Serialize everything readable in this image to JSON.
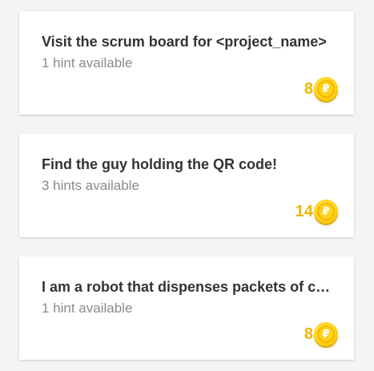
{
  "colors": {
    "title": "#333333",
    "hint": "#8a8a8a",
    "reward": "#f0b400",
    "coin": "#ffd31a"
  },
  "quests": [
    {
      "title": "Visit the scrum board for <project_name>",
      "hints": "1 hint available",
      "reward": "8",
      "icon": "coin-icon"
    },
    {
      "title": "Find the guy holding the QR code!",
      "hints": "3 hints available",
      "reward": "14",
      "icon": "coin-icon"
    },
    {
      "title": "I am a robot that dispenses packets of candy",
      "hints": "1 hint available",
      "reward": "8",
      "icon": "coin-icon"
    }
  ],
  "coin_symbol": "₽"
}
